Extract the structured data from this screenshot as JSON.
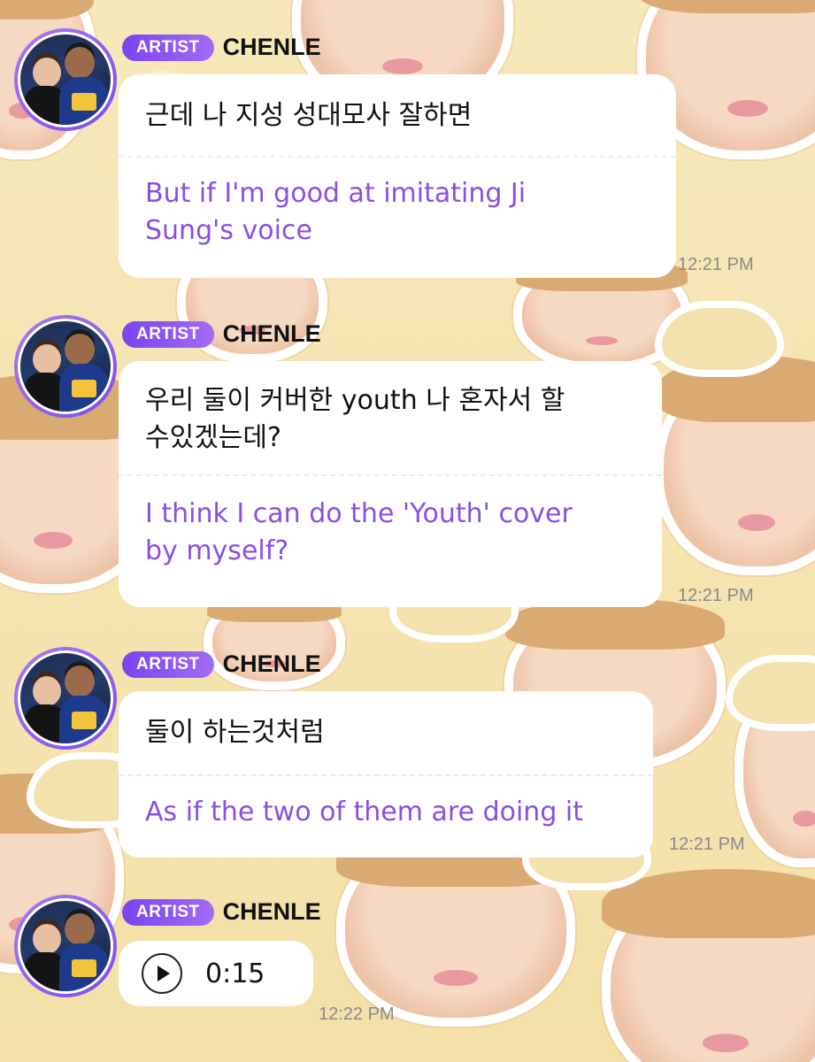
{
  "theme": {
    "accent": "#8b4fe0",
    "badge_gradient": [
      "#7a44f0",
      "#a46bf5"
    ],
    "bubble_bg": "#ffffff",
    "background": "#f6e6b4"
  },
  "messages": [
    {
      "badge": "ARTIST",
      "sender": "CHENLE",
      "original": "근데 나 지성 성대모사 잘하면",
      "translation_lines": [
        "But if I'm good at imitating Ji",
        "Sung's voice"
      ],
      "time": "12:21 PM"
    },
    {
      "badge": "ARTIST",
      "sender": "CHENLE",
      "original_lines": [
        "우리 둘이 커버한 youth 나 혼자서 할",
        "수있겠는데?"
      ],
      "translation_lines": [
        "I think I can do the 'Youth' cover",
        "by myself?"
      ],
      "time": "12:21 PM"
    },
    {
      "badge": "ARTIST",
      "sender": "CHENLE",
      "original": "둘이 하는것처럼",
      "translation": "As if the two of them are doing it",
      "time": "12:21 PM"
    },
    {
      "badge": "ARTIST",
      "sender": "CHENLE",
      "audio_duration": "0:15",
      "time": "12:22 PM"
    }
  ]
}
